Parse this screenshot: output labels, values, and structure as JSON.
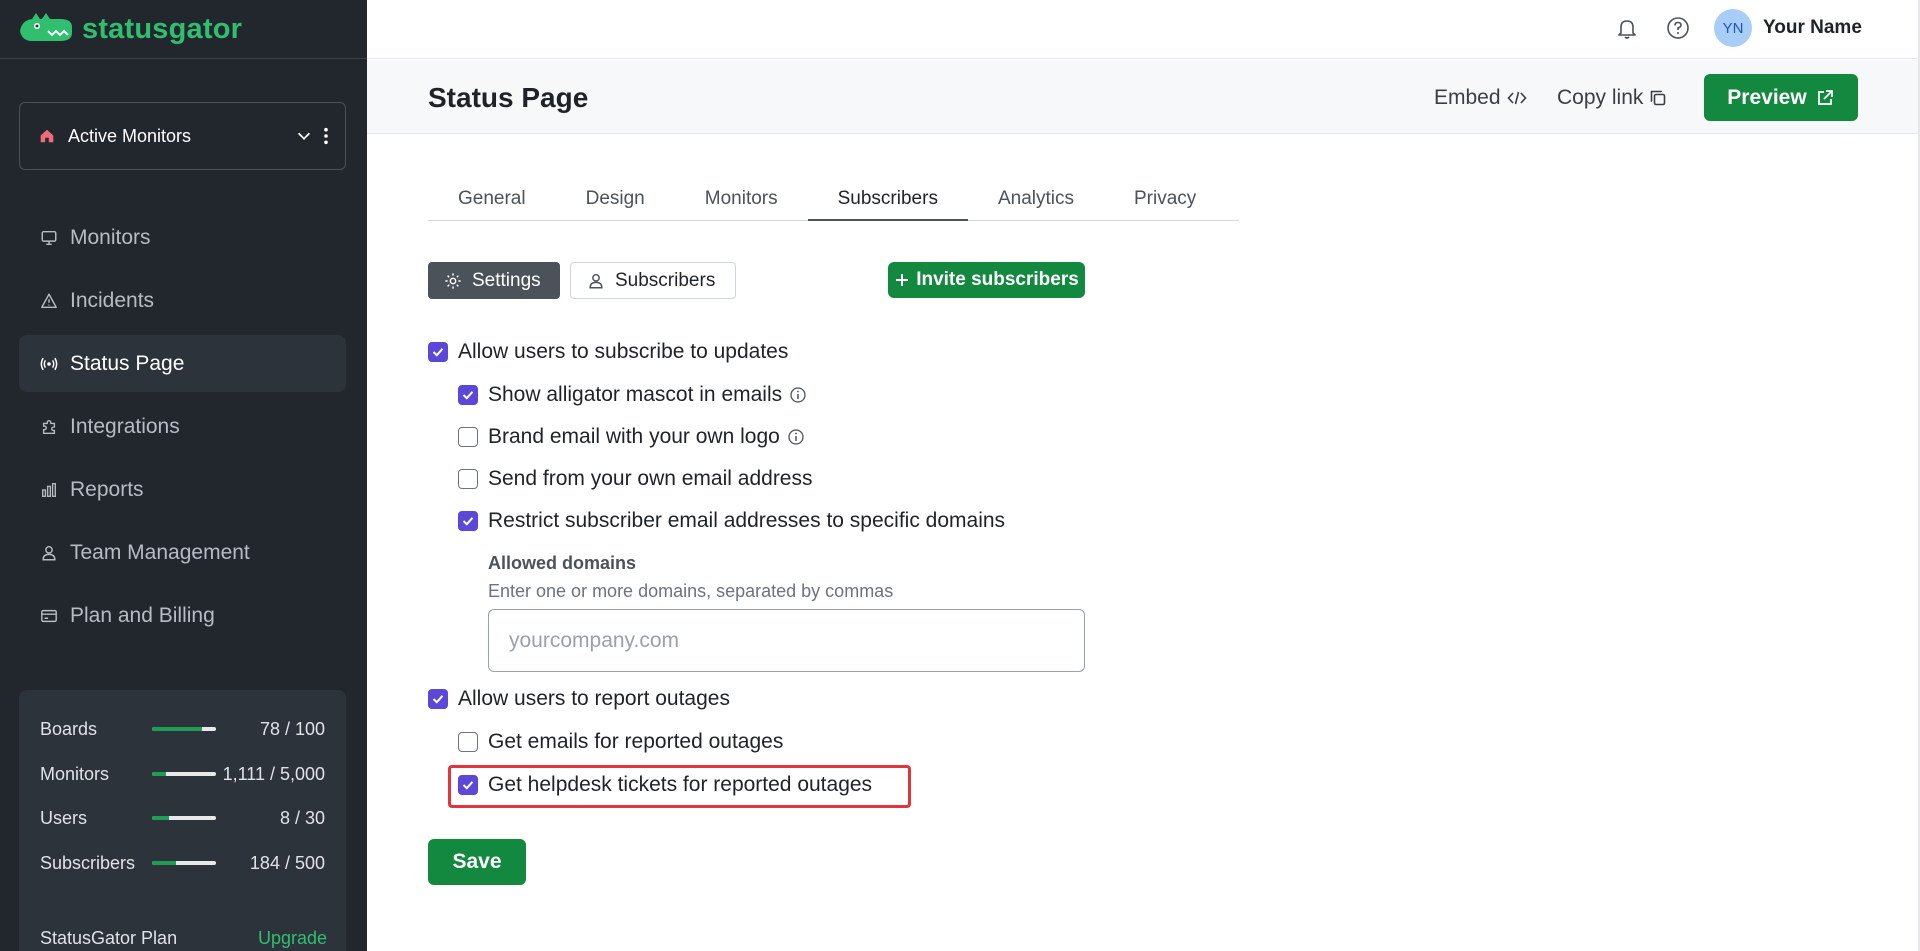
{
  "app": {
    "name": "statusgator"
  },
  "sidebar": {
    "monitor_select": {
      "label": "Active Monitors"
    },
    "nav": [
      {
        "label": "Monitors",
        "icon": "monitor-icon"
      },
      {
        "label": "Incidents",
        "icon": "warning-icon"
      },
      {
        "label": "Status Page",
        "icon": "broadcast-icon",
        "active": true
      },
      {
        "label": "Integrations",
        "icon": "puzzle-icon"
      },
      {
        "label": "Reports",
        "icon": "bar-chart-icon"
      },
      {
        "label": "Team Management",
        "icon": "user-icon"
      },
      {
        "label": "Plan and Billing",
        "icon": "credit-card-icon"
      }
    ],
    "usage": [
      {
        "label": "Boards",
        "value": "78 / 100",
        "fraction": 0.78
      },
      {
        "label": "Monitors",
        "value": "1,111 / 5,000",
        "fraction": 0.222
      },
      {
        "label": "Users",
        "value": "8 / 30",
        "fraction": 0.267
      },
      {
        "label": "Subscribers",
        "value": "184 / 500",
        "fraction": 0.368
      }
    ],
    "plan": {
      "label": "StatusGator Plan",
      "upgrade": "Upgrade"
    }
  },
  "header": {
    "user": {
      "initials": "YN",
      "name": "Your Name"
    }
  },
  "page": {
    "title": "Status Page",
    "embed_label": "Embed",
    "copy_link_label": "Copy link",
    "preview_label": "Preview"
  },
  "tabs": [
    {
      "label": "General"
    },
    {
      "label": "Design"
    },
    {
      "label": "Monitors"
    },
    {
      "label": "Subscribers",
      "active": true
    },
    {
      "label": "Analytics"
    },
    {
      "label": "Privacy"
    }
  ],
  "subtabs": {
    "settings_label": "Settings",
    "subscribers_label": "Subscribers",
    "invite_label": "Invite subscribers"
  },
  "options": {
    "allow_subscribe": {
      "label": "Allow users to subscribe to updates",
      "checked": true
    },
    "show_mascot": {
      "label": "Show alligator mascot in emails",
      "checked": true
    },
    "brand_logo": {
      "label": "Brand email with your own logo",
      "checked": false
    },
    "own_email": {
      "label": "Send from your own email address",
      "checked": false
    },
    "restrict_domains": {
      "label": "Restrict subscriber email addresses to specific domains",
      "checked": true
    },
    "allowed_domains": {
      "label": "Allowed domains",
      "help": "Enter one or more domains, separated by commas",
      "placeholder": "yourcompany.com",
      "value": ""
    },
    "allow_report": {
      "label": "Allow users to report outages",
      "checked": true
    },
    "report_emails": {
      "label": "Get emails for reported outages",
      "checked": false
    },
    "report_helpdesk": {
      "label": "Get helpdesk tickets for reported outages",
      "checked": true
    }
  },
  "save_label": "Save",
  "colors": {
    "sidebar_bg": "#22272e",
    "brand_green": "#13883f",
    "checkbox_purple": "#5b48d9",
    "highlight_red": "#e5333b"
  }
}
